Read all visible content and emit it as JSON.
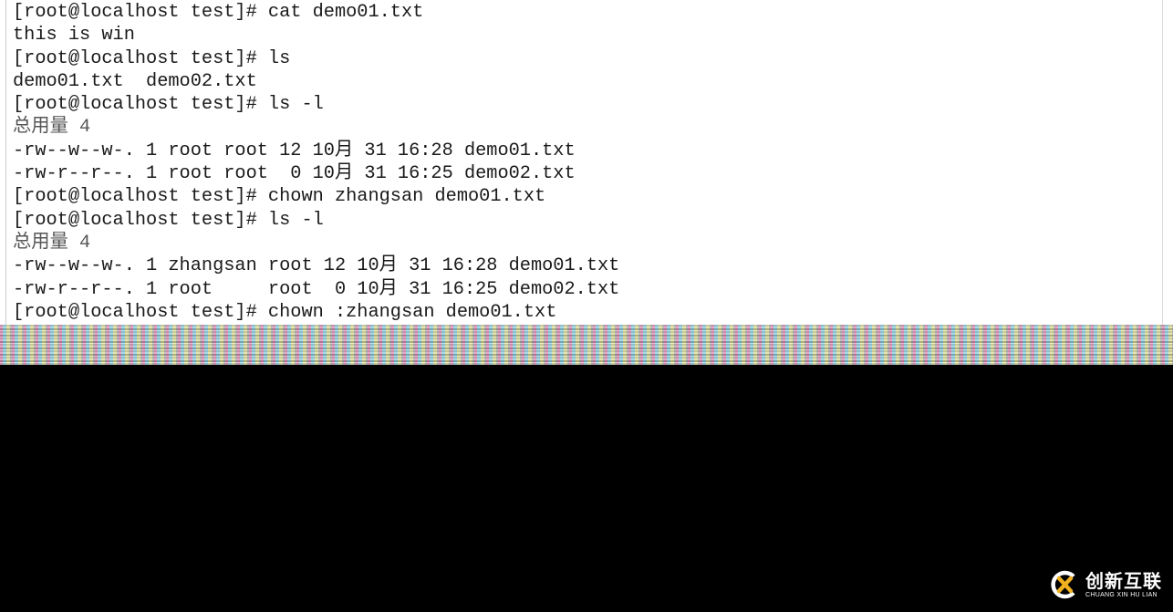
{
  "terminal": {
    "lines": [
      "[root@localhost test]# cat demo01.txt",
      "this is win",
      "[root@localhost test]# ls",
      "demo01.txt  demo02.txt",
      "[root@localhost test]# ls -l",
      "总用量 4",
      "-rw--w--w-. 1 root root 12 10月 31 16:28 demo01.txt",
      "-rw-r--r--. 1 root root  0 10月 31 16:25 demo02.txt",
      "[root@localhost test]# chown zhangsan demo01.txt",
      "[root@localhost test]# ls -l",
      "总用量 4",
      "-rw--w--w-. 1 zhangsan root 12 10月 31 16:28 demo01.txt",
      "-rw-r--r--. 1 root     root  0 10月 31 16:25 demo02.txt",
      "[root@localhost test]# chown :zhangsan demo01.txt"
    ]
  },
  "watermark": {
    "name_cn": "创新互联",
    "name_en": "CHUANG XIN HU LIAN",
    "accent": "#f0b020"
  }
}
